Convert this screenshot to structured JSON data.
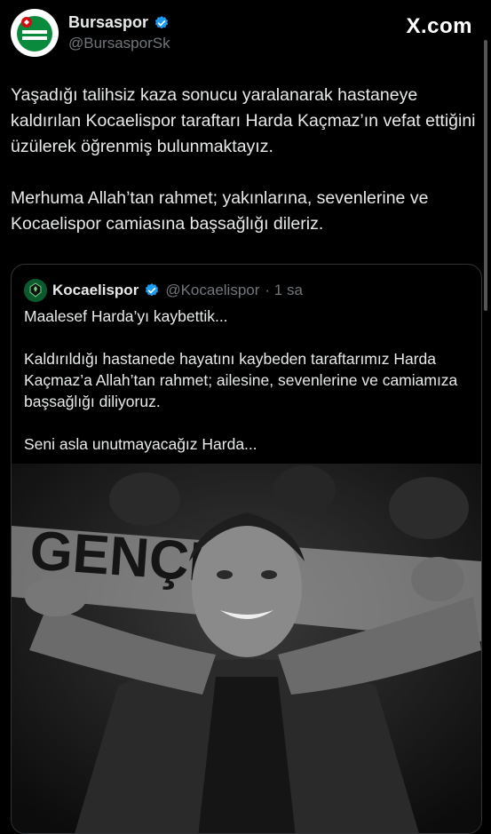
{
  "author": {
    "name": "Bursaspor",
    "handle": "@BursasporSk",
    "avatar_icon": "bursaspor-crest-icon",
    "verified_icon": "verified-badge-icon"
  },
  "brand": {
    "label": "X.com"
  },
  "tweet": {
    "text": "Yaşadığı talihsiz kaza sonucu yaralanarak hastaneye kaldırılan Kocaelispor taraftarı Harda Kaçmaz’ın vefat ettiğini üzülerek öğrenmiş bulunmaktayız.\n\nMerhuma Allah’tan rahmet; yakınlarına, sevenlerine ve Kocaelispor camiasına başsağlığı dileriz."
  },
  "quote": {
    "name": "Kocaelispor",
    "handle": "@Kocaelispor",
    "time": "· 1 sa",
    "avatar_icon": "kocaelispor-crest-icon",
    "text": "Maalesef Harda’yı kaybettik...\n\nKaldırıldığı hastanede hayatını kaybeden taraftarımız Harda Kaçmaz’a Allah’tan rahmet; ailesine, sevenlerine ve camiamıza başsağlığı diliyoruz.\n\nSeni asla unutmayacağız Harda...",
    "photo_banner_text": "GENÇLİK"
  },
  "colors": {
    "background": "#000000",
    "text": "#e7e9ea",
    "muted": "#71767b",
    "verified": "#1d9bf0",
    "border": "#2f3336"
  }
}
